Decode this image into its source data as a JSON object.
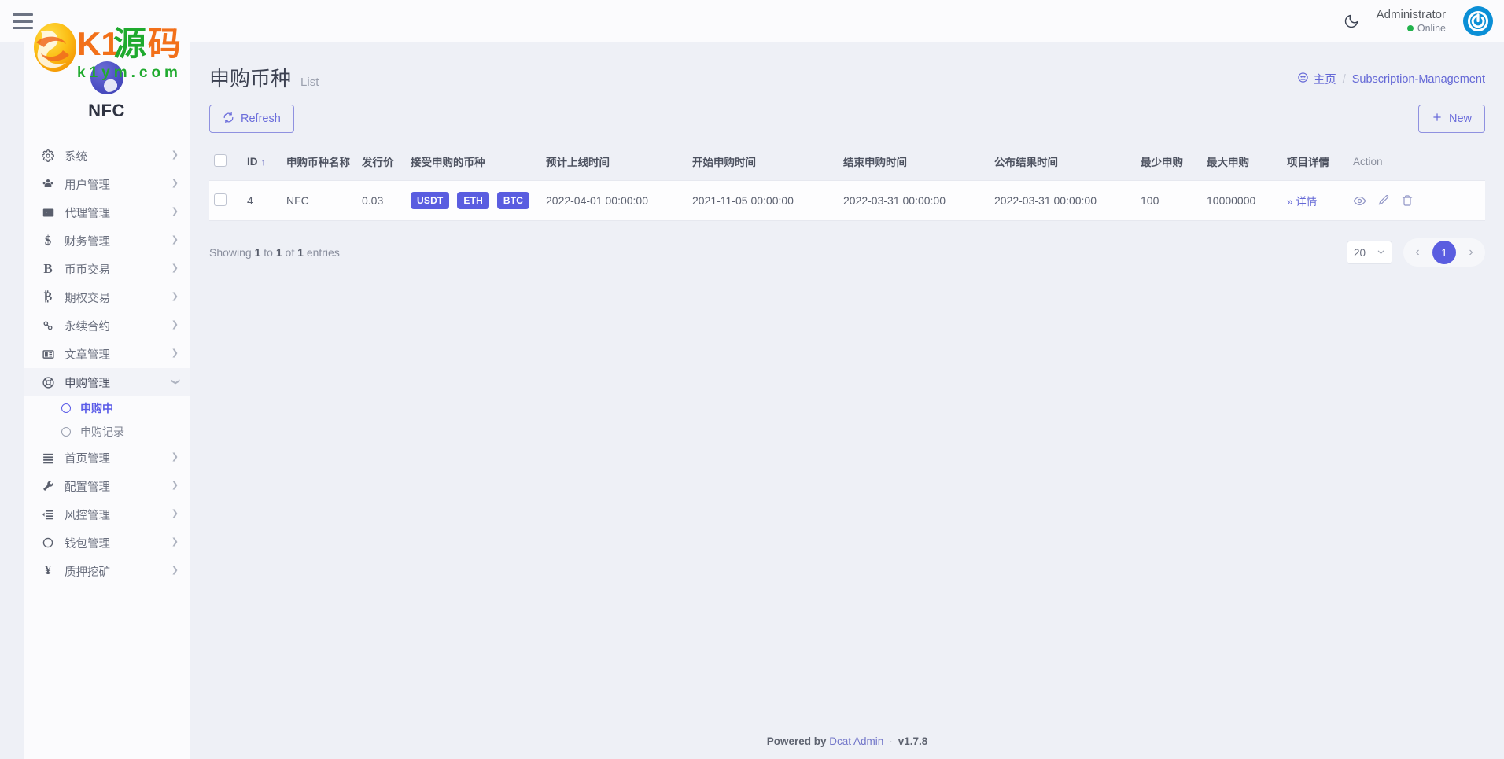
{
  "topbar": {
    "menu_toggle": "hamburger-menu",
    "dark_mode_icon": "moon-icon",
    "user_name": "Administrator",
    "user_status": "Online",
    "status_color": "#22b24c",
    "avatar_icon": "power-logo-icon",
    "avatar_color": "#0b8fd6"
  },
  "watermark": {
    "title": "K1源码",
    "domain": "k1ym.com"
  },
  "sidebar": {
    "brand_name": "NFC",
    "items": [
      {
        "label": "系统",
        "icon": "gear-icon",
        "has_children": true,
        "active": false
      },
      {
        "label": "用户管理",
        "icon": "user-group-icon",
        "has_children": true,
        "active": false
      },
      {
        "label": "代理管理",
        "icon": "id-card-icon",
        "has_children": true,
        "active": false
      },
      {
        "label": "财务管理",
        "icon": "dollar-icon",
        "has_children": true,
        "active": false
      },
      {
        "label": "币币交易",
        "icon": "letter-b-icon",
        "has_children": true,
        "active": false
      },
      {
        "label": "期权交易",
        "icon": "bitcoin-icon",
        "has_children": true,
        "active": false
      },
      {
        "label": "永续合约",
        "icon": "link-chain-icon",
        "has_children": true,
        "active": false
      },
      {
        "label": "文章管理",
        "icon": "article-icon",
        "has_children": true,
        "active": false
      },
      {
        "label": "申购管理",
        "icon": "lifebuoy-icon",
        "has_children": true,
        "active": true
      },
      {
        "label": "首页管理",
        "icon": "bars-icon",
        "has_children": true,
        "active": false
      },
      {
        "label": "配置管理",
        "icon": "wrench-icon",
        "has_children": true,
        "active": false
      },
      {
        "label": "风控管理",
        "icon": "indent-list-icon",
        "has_children": true,
        "active": false
      },
      {
        "label": "钱包管理",
        "icon": "circle-icon",
        "has_children": true,
        "active": false
      },
      {
        "label": "质押挖矿",
        "icon": "yen-icon",
        "has_children": true,
        "active": false
      }
    ],
    "submenu": [
      {
        "label": "申购中",
        "active": true
      },
      {
        "label": "申购记录",
        "active": false
      }
    ],
    "accent_color": "#5b5ce8"
  },
  "page": {
    "title": "申购币种",
    "subtitle": "List",
    "breadcrumb_home": "主页",
    "breadcrumb_sep": "/",
    "breadcrumb_current": "Subscription-Management"
  },
  "toolbar": {
    "refresh_label": "Refresh",
    "refresh_icon": "refresh-icon",
    "new_label": "New",
    "new_icon": "plus-icon"
  },
  "table": {
    "headers": [
      "ID",
      "申购币种名称",
      "发行价",
      "接受申购的币种",
      "预计上线时间",
      "开始申购时间",
      "结束申购时间",
      "公布结果时间",
      "最少申购",
      "最大申购",
      "项目详情",
      "Action"
    ],
    "sort_column": "ID",
    "sort_direction": "asc",
    "rows": [
      {
        "id": "4",
        "name": "NFC",
        "issue_price": "0.03",
        "accepted_coins": [
          "USDT",
          "ETH",
          "BTC"
        ],
        "expected_online_time": "2022-04-01 00:00:00",
        "start_time": "2021-11-05 00:00:00",
        "end_time": "2022-03-31 00:00:00",
        "result_time": "2022-03-31 00:00:00",
        "min_subscription": "100",
        "max_subscription": "10000000",
        "detail_link": "» 详情",
        "actions": [
          "view-icon",
          "edit-icon",
          "delete-icon"
        ]
      }
    ],
    "badge_color": "#5a5de0"
  },
  "pagination": {
    "showing_prefix": "Showing",
    "from": "1",
    "to_word": "to",
    "to": "1",
    "of_word": "of",
    "total": "1",
    "entries_word": "entries",
    "page_size": "20",
    "prev_icon": "chevron-left-icon",
    "next_icon": "chevron-right-icon",
    "current_page": "1",
    "active_color": "#5a5de0"
  },
  "footer": {
    "powered_by": "Powered by",
    "brand": "Dcat Admin",
    "separator": "·",
    "version": "v1.7.8"
  }
}
